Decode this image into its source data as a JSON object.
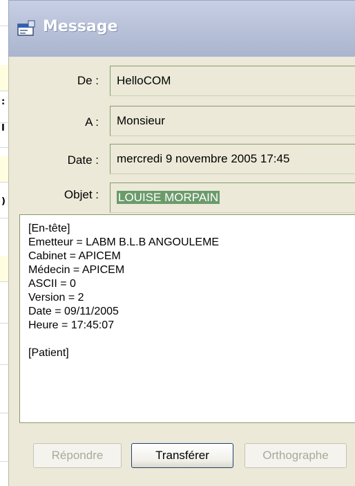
{
  "window": {
    "title": "Message",
    "icon": "message-window-icon"
  },
  "fields": {
    "from": {
      "label": "De :",
      "value": "HelloCOM"
    },
    "to": {
      "label": "A :",
      "value": "Monsieur"
    },
    "date": {
      "label": "Date :",
      "value": "mercredi 9 novembre 2005 17:45"
    },
    "subject": {
      "label": "Objet :",
      "value": "LOUISE MORPAIN"
    }
  },
  "message": {
    "lines": [
      "[En-tête]",
      "Emetteur = LABM B.L.B ANGOULEME",
      "Cabinet = APICEM",
      "Médecin = APICEM",
      "ASCII = 0",
      "Version = 2",
      "Date = 09/11/2005",
      "Heure = 17:45:07",
      "",
      "[Patient]"
    ]
  },
  "buttons": {
    "reply": {
      "label": "Répondre",
      "enabled": false
    },
    "forward": {
      "label": "Transférer",
      "enabled": true
    },
    "spelling": {
      "label": "Orthographe",
      "enabled": false
    }
  },
  "colors": {
    "window_bg": "#ece9d8",
    "selection": "#6b9b6b",
    "title_text": "#ffffff"
  }
}
